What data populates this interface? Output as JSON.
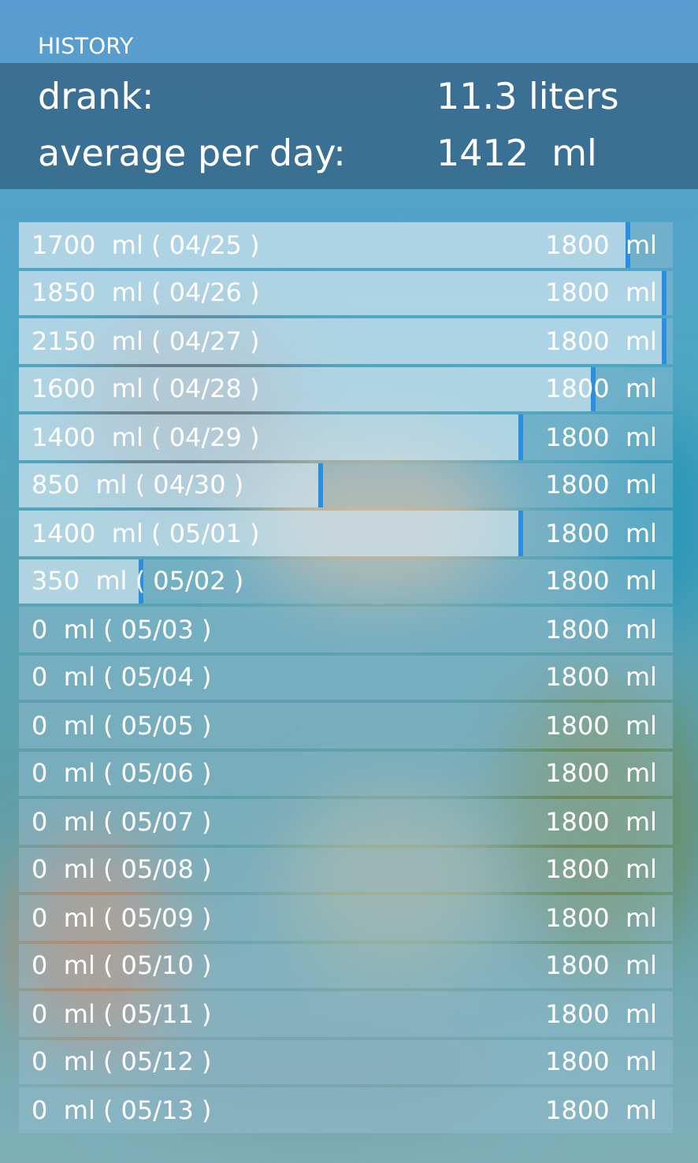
{
  "title": "HISTORY",
  "summary": [
    {
      "label": "drank:",
      "value": "11.3 liters"
    },
    {
      "label": "average per day:",
      "value": "1412  ml"
    }
  ],
  "days": [
    {
      "amount": "1700  ml ( 04/25 )",
      "goal": "1800  ml",
      "level": 0.935
    },
    {
      "amount": "1850  ml ( 04/26 )",
      "goal": "1800  ml",
      "level": 0.99
    },
    {
      "amount": "2150  ml ( 04/27 )",
      "goal": "1800  ml",
      "level": 0.99
    },
    {
      "amount": "1600  ml ( 04/28 )",
      "goal": "1800  ml",
      "level": 0.882
    },
    {
      "amount": "1400  ml ( 04/29 )",
      "goal": "1800  ml",
      "level": 0.77
    },
    {
      "amount": "850  ml ( 04/30 )",
      "goal": "1800  ml",
      "level": 0.465
    },
    {
      "amount": "1400  ml ( 05/01 )",
      "goal": "1800  ml",
      "level": 0.77
    },
    {
      "amount": "350  ml ( 05/02 )",
      "goal": "1800  ml",
      "level": 0.19
    },
    {
      "amount": "0  ml ( 05/03 )",
      "goal": "1800  ml"
    },
    {
      "amount": "0  ml ( 05/04 )",
      "goal": "1800  ml"
    },
    {
      "amount": "0  ml ( 05/05 )",
      "goal": "1800  ml"
    },
    {
      "amount": "0  ml ( 05/06 )",
      "goal": "1800  ml"
    },
    {
      "amount": "0  ml ( 05/07 )",
      "goal": "1800  ml"
    },
    {
      "amount": "0  ml ( 05/08 )",
      "goal": "1800  ml"
    },
    {
      "amount": "0  ml ( 05/09 )",
      "goal": "1800  ml"
    },
    {
      "amount": "0  ml ( 05/10 )",
      "goal": "1800  ml"
    },
    {
      "amount": "0  ml ( 05/11 )",
      "goal": "1800  ml"
    },
    {
      "amount": "0  ml ( 05/12 )",
      "goal": "1800  ml"
    },
    {
      "amount": "0  ml ( 05/13 )",
      "goal": "1800  ml"
    }
  ]
}
